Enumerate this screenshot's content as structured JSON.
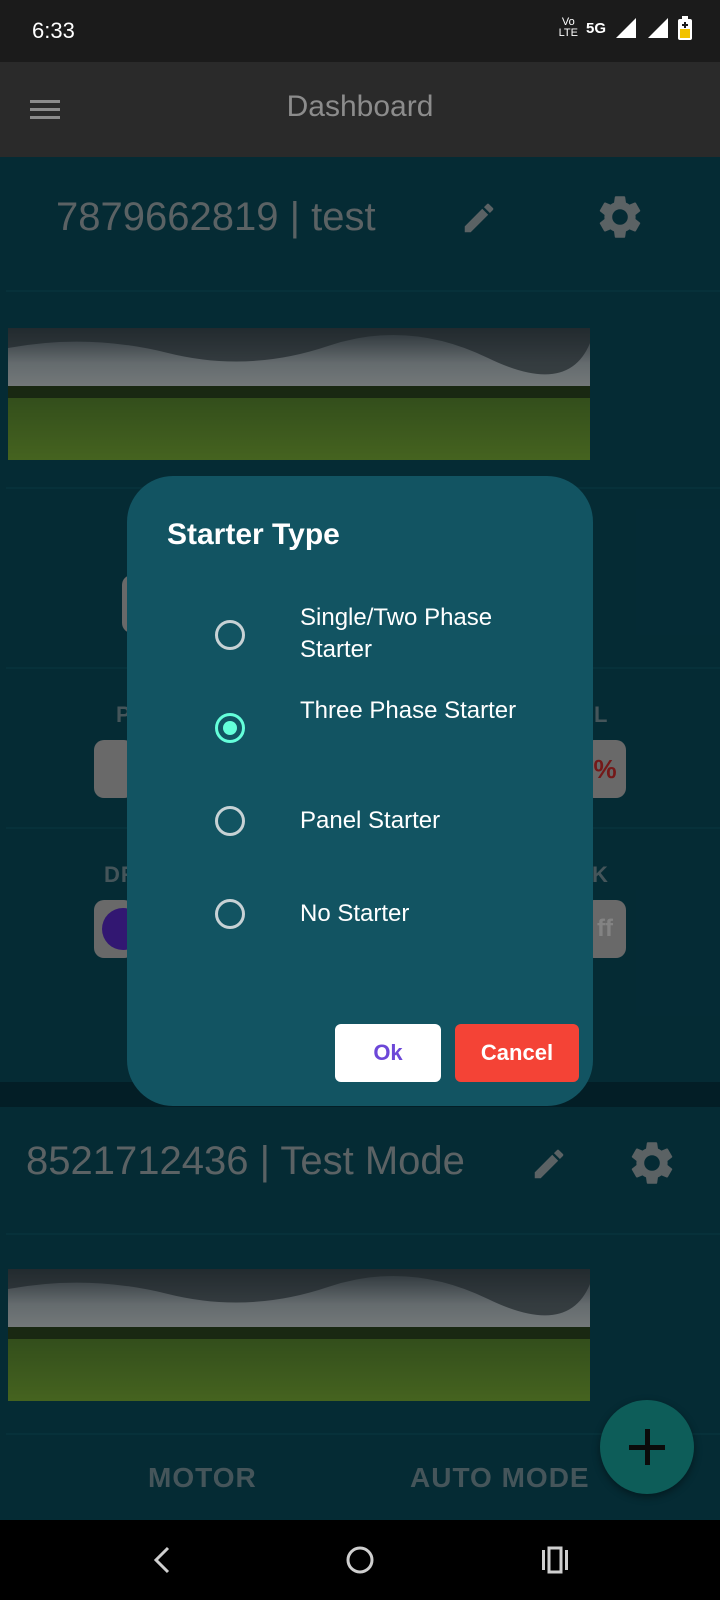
{
  "status_bar": {
    "time": "6:33",
    "volte_top": "Vo",
    "volte_bottom": "LTE",
    "network": "5G"
  },
  "app_bar": {
    "title": "Dashboard"
  },
  "cards": [
    {
      "title": "7879662819 | test",
      "partial_labels": [
        "P",
        "L",
        "DR",
        "K"
      ],
      "partial_value": "%",
      "partial_toggle": "ff"
    },
    {
      "title": "8521712436 | Test Mode",
      "motor_label": "MOTOR",
      "auto_mode_label": "AUTO MODE"
    }
  ],
  "dialog": {
    "title": "Starter Type",
    "options": [
      {
        "label": "Single/Two Phase Starter",
        "selected": false
      },
      {
        "label": "Three Phase Starter",
        "selected": true
      },
      {
        "label": "Panel Starter",
        "selected": false
      },
      {
        "label": "No Starter",
        "selected": false
      }
    ],
    "ok_label": "Ok",
    "cancel_label": "Cancel"
  },
  "colors": {
    "accent": "#64ffda",
    "dialog_bg": "#125462",
    "cancel": "#f44336",
    "fab": "#0d5d59"
  }
}
